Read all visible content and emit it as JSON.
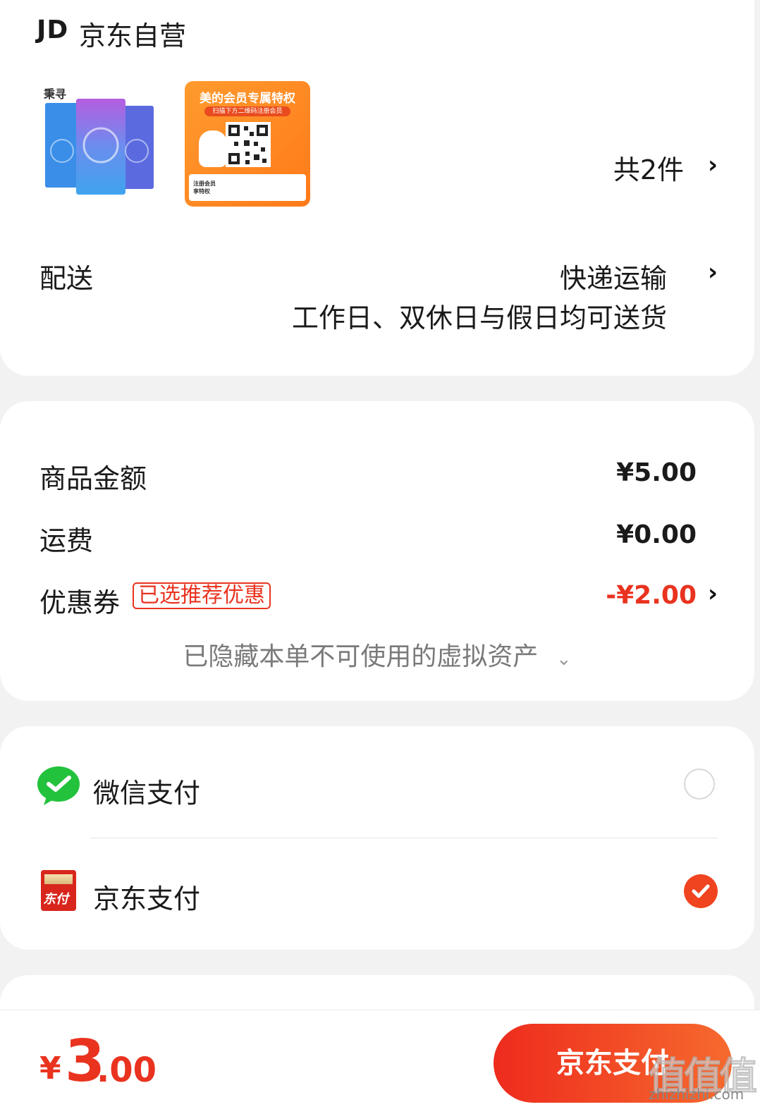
{
  "shop": {
    "logo": "JD",
    "name": "京东自营",
    "item_count": "共2件",
    "thumb1_brand": "秉寻",
    "promo": {
      "title": "美的会员专属特权",
      "subtitle": "扫描下方二维码注册会员",
      "footer_left": "注册会员 享特权"
    }
  },
  "delivery": {
    "label": "配送",
    "method": "快递运输",
    "note": "工作日、双休日与假日均可送货"
  },
  "summary": {
    "goods_label": "商品金额",
    "goods_amount": "¥5.00",
    "shipping_label": "运费",
    "shipping_amount": "¥0.00",
    "coupon_label": "优惠券",
    "coupon_tag": "已选推荐优惠",
    "coupon_amount": "-¥2.00",
    "hidden_assets": "已隐藏本单不可使用的虚拟资产"
  },
  "payment": {
    "wechat_label": "微信支付",
    "wechat_selected": false,
    "jd_label": "京东支付",
    "jd_icon_text": "东付",
    "jd_selected": true
  },
  "footer": {
    "currency": "¥",
    "total_int": "3",
    "total_dec": ".00",
    "pay_button": "京东支付"
  },
  "watermark": {
    "main": "值值值",
    "sub": "zhizhizhi.com"
  },
  "colors": {
    "accent": "#e9331f",
    "wechat_green": "#23c23c"
  }
}
